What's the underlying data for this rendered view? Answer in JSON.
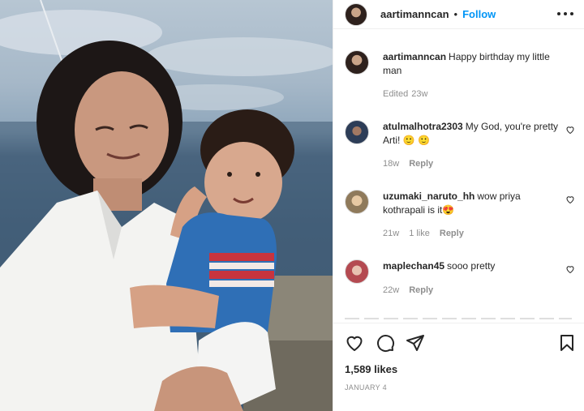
{
  "post": {
    "author": "aartimanncan",
    "separator": "•",
    "follow_label": "Follow",
    "more_icon": "more-horizontal-icon",
    "photo_alt_icon": "post-photo"
  },
  "caption": {
    "username": "aartimanncan",
    "text": "Happy birthday my little man",
    "edited": "Edited",
    "time": "23w"
  },
  "comments": [
    {
      "username": "atulmalhotra2303",
      "text": "My God, you're pretty Arti! 🙂 🙂",
      "time": "18w",
      "likes": "",
      "reply": "Reply"
    },
    {
      "username": "uzumaki_naruto_hh",
      "text": "wow priya kothrapali is it😍",
      "time": "21w",
      "likes": "1 like",
      "reply": "Reply"
    },
    {
      "username": "maplechan45",
      "text": "sooo pretty",
      "time": "22w",
      "likes": "",
      "reply": "Reply"
    }
  ],
  "actions": {
    "like_icon": "heart-icon",
    "comment_icon": "comment-icon",
    "share_icon": "share-icon",
    "save_icon": "bookmark-icon"
  },
  "likes": "1,589 likes",
  "date": "JANUARY 4"
}
